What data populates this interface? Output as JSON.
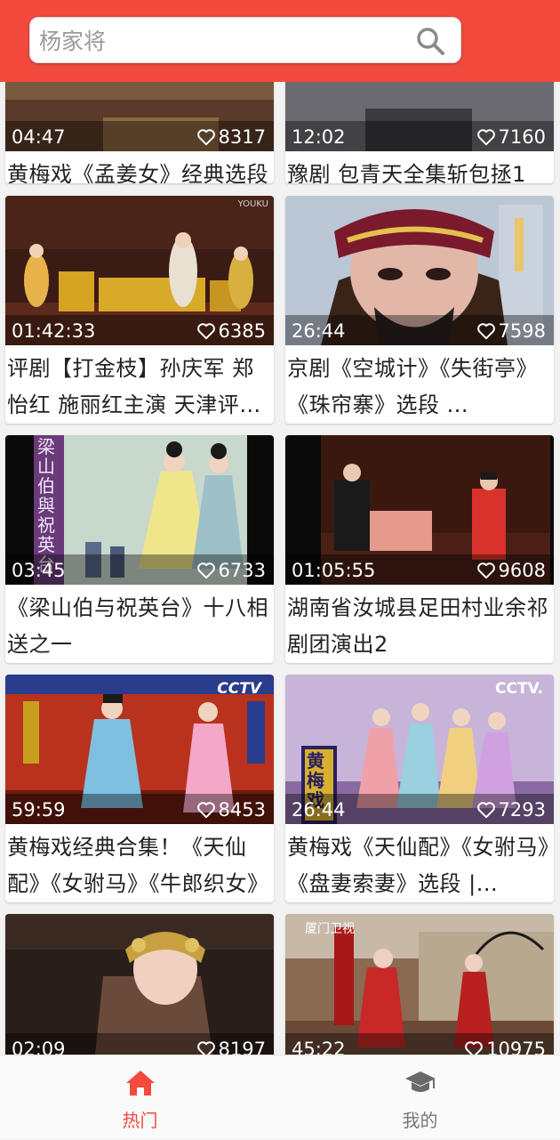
{
  "search": {
    "placeholder": "杨家将"
  },
  "cards": [
    {
      "duration": "04:47",
      "likes": "8317",
      "title": "黄梅戏《孟姜女》经典选段"
    },
    {
      "duration": "12:02",
      "likes": "7160",
      "title": "豫剧 包青天全集斩包拯1"
    },
    {
      "duration": "01:42:33",
      "likes": "6385",
      "title": "评剧【打金枝】孙庆军 郑怡红 施丽红主演 天津评剧院"
    },
    {
      "duration": "26:44",
      "likes": "7598",
      "title": "京剧《空城计》《失街亭》《珠帘寨》选段 ..."
    },
    {
      "duration": "03:45",
      "likes": "6733",
      "title": "《梁山伯与祝英台》十八相送之一"
    },
    {
      "duration": "01:05:55",
      "likes": "9608",
      "title": "湖南省汝城县足田村业余祁剧团演出2"
    },
    {
      "duration": "59:59",
      "likes": "8453",
      "title": "黄梅戏经典合集！《天仙配》《女驸马》《牛郎织女》"
    },
    {
      "duration": "26:44",
      "likes": "7293",
      "title": " 黄梅戏《天仙配》《女驸马》《盘妻索妻》选段 |..."
    },
    {
      "duration": "02:09",
      "likes": "8197",
      "title": ""
    },
    {
      "duration": "45:22",
      "likes": "10975",
      "title": ""
    }
  ],
  "thumb_text": {
    "youku": "YOUKU",
    "cctv": "CCTV",
    "cctv_dot": "CCTV.",
    "liangshanbo": "梁山伯與祝英台",
    "huangmeixi": "黄梅戏",
    "xiamen": "厦门卫视"
  },
  "tabs": [
    {
      "label": "热门",
      "active": true,
      "icon": "home-icon"
    },
    {
      "label": "我的",
      "active": false,
      "icon": "graduation-cap-icon"
    }
  ],
  "colors": {
    "accent": "#f24a3d",
    "inactive": "#777777"
  }
}
